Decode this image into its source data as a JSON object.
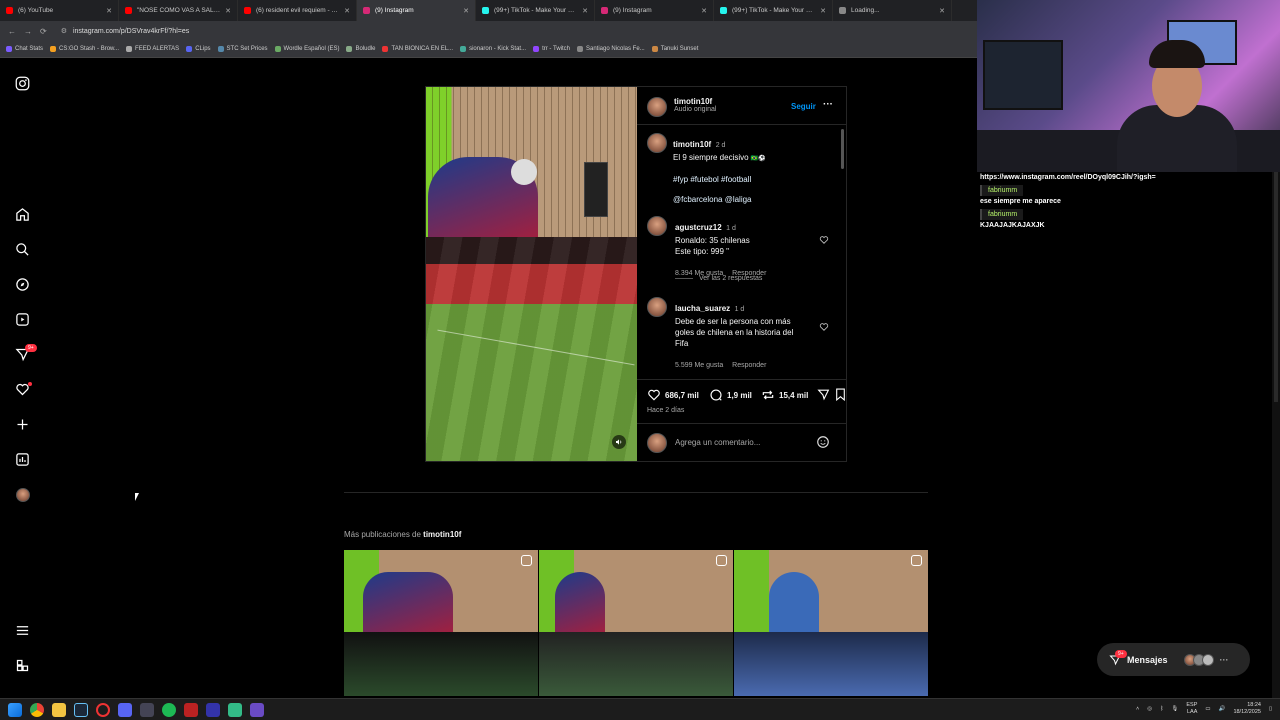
{
  "browser": {
    "tabs": [
      {
        "label": "(6) YouTube",
        "color": "#ff0000",
        "active": false
      },
      {
        "label": "\"NOSE COMO VAS A SALIR\" M...",
        "color": "#ff0000",
        "active": false
      },
      {
        "label": "(6) resident evil requiem - YouT",
        "color": "#ff0000",
        "active": false
      },
      {
        "label": "(9) Instagram",
        "color": "#d62976",
        "active": true
      },
      {
        "label": "(99+) TikTok - Make Your Day",
        "color": "#25f4ee",
        "active": false
      },
      {
        "label": "(9) Instagram",
        "color": "#d62976",
        "active": false
      },
      {
        "label": "(99+) TikTok - Make Your Day",
        "color": "#25f4ee",
        "active": false
      },
      {
        "label": "Loading...",
        "color": "#888888",
        "active": false
      }
    ],
    "url": "instagram.com/p/DSVrav4krFf/?hl=es",
    "bookmarks": [
      "Chat Stats",
      "CS:GO Stash - Brow...",
      "FEED ALERTAS",
      "CLips",
      "STC Set Prices",
      "Wordle Español (ES)",
      "Boludle",
      "TAN BIONICA EN EL...",
      "sionaron - Kick Stat...",
      "trr - Twitch",
      "Santiago Nicolas Fe...",
      "Tanuki Sunset"
    ]
  },
  "sidebar": {
    "items": [
      "instagram-logo-icon",
      "home-icon",
      "search-icon",
      "explore-icon",
      "reels-icon",
      "messages-icon",
      "notifications-icon",
      "create-icon",
      "dashboard-icon",
      "profile-avatar",
      "menu-icon",
      "threads-icon"
    ],
    "messages_badge": "9+"
  },
  "post": {
    "author": "timotin10f",
    "audio": "Audio original",
    "follow_label": "Seguir",
    "caption_user": "timotin10f",
    "caption_time": "2 d",
    "caption_text": "El 9 siempre decisivo",
    "hashtags": "#fyp #futebol #football",
    "mentions": "@fcbarcelona @laliga",
    "comments": [
      {
        "user": "agustcruz12",
        "time": "1 d",
        "line1": "Ronaldo: 35 chilenas",
        "line2": "Este tipo: 999 \"",
        "likes": "8.394 Me gusta",
        "reply": "Responder"
      },
      {
        "user": "laucha_suarez",
        "time": "1 d",
        "line1": "Debe de ser la persona con más",
        "line2": "goles de chilena en la historia del",
        "line3": "Fifa",
        "likes": "5.599 Me gusta",
        "reply": "Responder"
      }
    ],
    "view_replies": "Ver las 2 respuestas",
    "likes": "686,7 mil",
    "comments_count": "1,9 mil",
    "reposts": "15,4 mil",
    "posted": "Hace 2 días",
    "add_comment_placeholder": "Agrega un comentario..."
  },
  "more_posts": {
    "prefix": "Más publicaciones de ",
    "user": "timotin10f"
  },
  "stream": {
    "chat": [
      {
        "type": "msg",
        "text": "https://www.instagram.com/reel/DOyql09CJih/?igsh="
      },
      {
        "type": "user",
        "text": "fabriumm"
      },
      {
        "type": "msg",
        "text": "ese siempre me aparece"
      },
      {
        "type": "user",
        "text": "fabriumm"
      },
      {
        "type": "msg",
        "text": "KJAAJAJKAJAXJK"
      }
    ]
  },
  "messages": {
    "label": "Mensajes",
    "badge": "9+"
  },
  "taskbar": {
    "lang1": "ESP",
    "lang2": "LAA",
    "time": "18:24",
    "date": "18/12/2025"
  }
}
